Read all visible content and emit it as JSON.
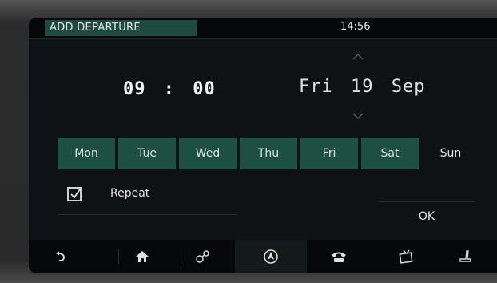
{
  "header": {
    "title": "ADD DEPARTURE",
    "clock": "14:56"
  },
  "time": {
    "hour": "09",
    "separator": ":",
    "minute": "00"
  },
  "date": {
    "weekday": "Fri",
    "day": "19",
    "month": "Sep"
  },
  "days": [
    {
      "label": "Mon",
      "selected": true
    },
    {
      "label": "Tue",
      "selected": true
    },
    {
      "label": "Wed",
      "selected": true
    },
    {
      "label": "Thu",
      "selected": true
    },
    {
      "label": "Fri",
      "selected": true
    },
    {
      "label": "Sat",
      "selected": true
    },
    {
      "label": "Sun",
      "selected": false
    }
  ],
  "repeat": {
    "label": "Repeat",
    "checked": true
  },
  "ok_label": "OK",
  "nav_icons": [
    "back-icon",
    "home-icon",
    "connections-icon",
    "navigation-icon",
    "phone-icon",
    "media-icon",
    "seat-icon"
  ],
  "colors": {
    "accent": "#1d4f43",
    "background": "#0e1214"
  }
}
